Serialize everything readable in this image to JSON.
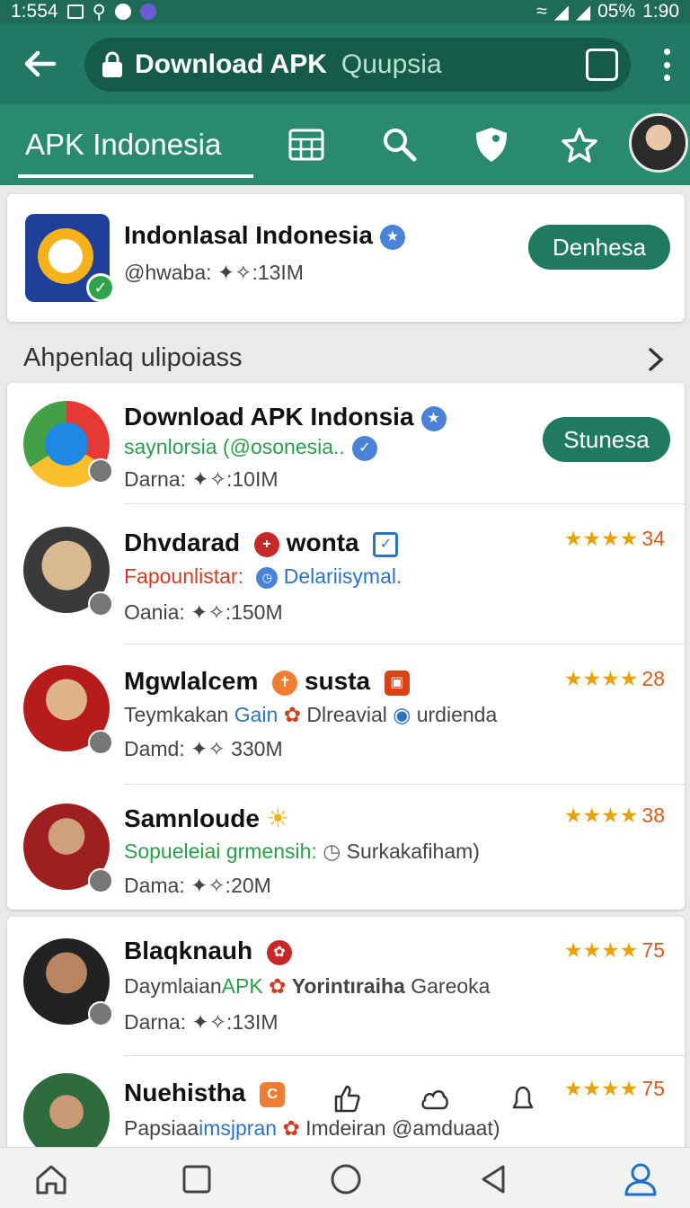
{
  "status": {
    "left_time": "1:554",
    "battery": "05%",
    "right_time": "1:90"
  },
  "toolbar": {
    "url_title": "Download APK",
    "url_extra": "Quupsia"
  },
  "tabs": {
    "active_label": "APK Indonesia",
    "icons": [
      "grid-icon",
      "search-icon",
      "shield-icon",
      "star-icon",
      "profile-avatar"
    ]
  },
  "featured": {
    "title": "Indonlasal Indonesia",
    "meta": "@hwaba: ✦✧:13IM",
    "button": "Denhesa"
  },
  "section": {
    "title": "Ahpenlaq ulipoiass"
  },
  "list": [
    {
      "title": "Download APK Indonsia",
      "line2": "saynlorsia (@osonesia..",
      "line3": "Darna: ✦✧:10IM",
      "button": "Stunesa"
    },
    {
      "title": "Dhvdarad",
      "title2": "wonta",
      "line2a": "Fapounlistar:",
      "line2b": "Delariisymal.",
      "line3": "Oania: ✦✧:150M",
      "stars": "★★★★",
      "count": "34"
    },
    {
      "title": "Mgwlalcem",
      "title2": "susta",
      "line2a": "Teymkakan",
      "line2b": "Gain",
      "line2c": "Dlreavial",
      "line2d": "urdienda",
      "line3": "Damd: ✦✧ 330M",
      "stars": "★★★★",
      "count": "28"
    },
    {
      "title": "Samnloude",
      "line2a": "Sopueleiai grmensih:",
      "line2b": "Surkakafiham)",
      "line3": "Dama: ✦✧:20M",
      "stars": "★★★★",
      "count": "38"
    }
  ],
  "list2": [
    {
      "title": "Blaqknauh",
      "line2a": "Daymlaian",
      "line2b": "APK",
      "line2c": "Yorintıraiha",
      "line2d": "Gareoka",
      "line3": "Darna: ✦✧:13IM",
      "stars": "★★★★",
      "count": "75"
    },
    {
      "title": "Nuehistha",
      "line2a": "Papsiaa",
      "line2b": "imsjpran",
      "line2c": "Imdeiran",
      "line2d": "@amduaat)",
      "stars": "★★★★",
      "count": "75"
    }
  ],
  "colors": {
    "appbar": "#207a63",
    "tabbar": "#2a8a70",
    "accent_button": "#1f7a61",
    "star": "#e8a300"
  }
}
